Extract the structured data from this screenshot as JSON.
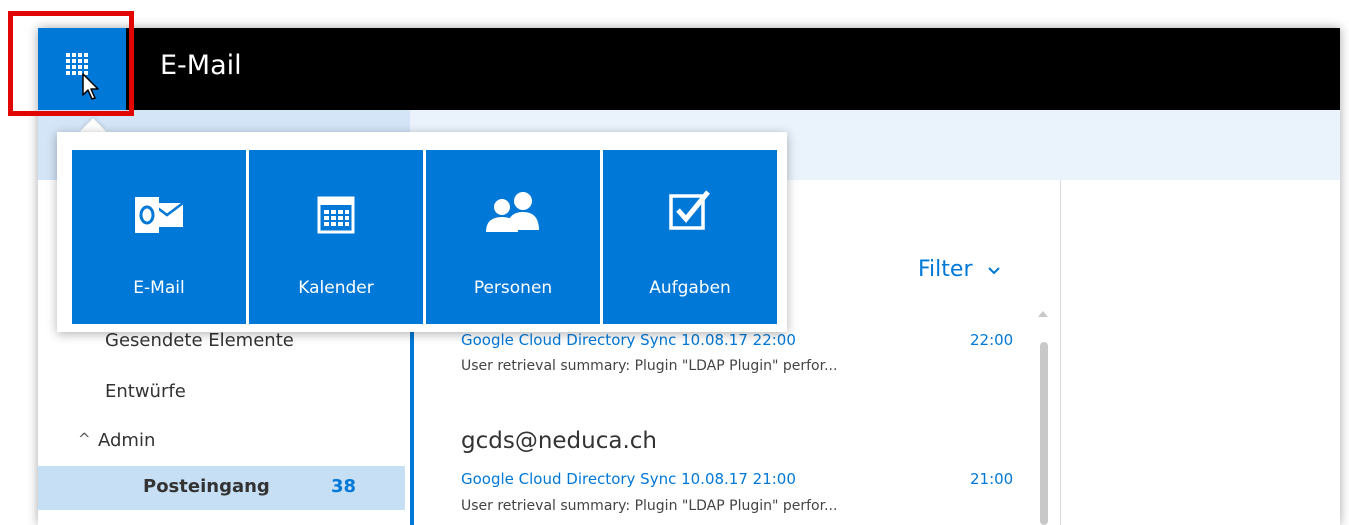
{
  "app": {
    "title": "E-Mail"
  },
  "launcher": {
    "tiles": [
      {
        "label": "E-Mail",
        "icon": "outlook-mail-icon"
      },
      {
        "label": "Kalender",
        "icon": "calendar-icon"
      },
      {
        "label": "Personen",
        "icon": "people-icon"
      },
      {
        "label": "Aufgaben",
        "icon": "tasks-checkbox-icon"
      }
    ]
  },
  "sidebar": {
    "items": [
      {
        "label": "Gesendete Elemente"
      },
      {
        "label": "Entwürfe"
      },
      {
        "label": "Admin",
        "expand_icon": "^"
      },
      {
        "label": "Posteingang",
        "count": "38"
      }
    ]
  },
  "list": {
    "filter_label": "Filter",
    "messages": [
      {
        "sender": "",
        "subject": "Google Cloud Directory Sync 10.08.17 22:00",
        "time": "22:00",
        "preview": "User retrieval summary: Plugin \"LDAP Plugin\" perfor..."
      },
      {
        "sender": "gcds@neduca.ch",
        "subject": "Google Cloud Directory Sync 10.08.17 21:00",
        "time": "21:00",
        "preview": "User retrieval summary: Plugin \"LDAP Plugin\" perfor..."
      }
    ]
  },
  "colors": {
    "accent": "#0078d7",
    "topbar": "#000000",
    "highlight": "#e10600",
    "selection": "#c7dff5"
  }
}
